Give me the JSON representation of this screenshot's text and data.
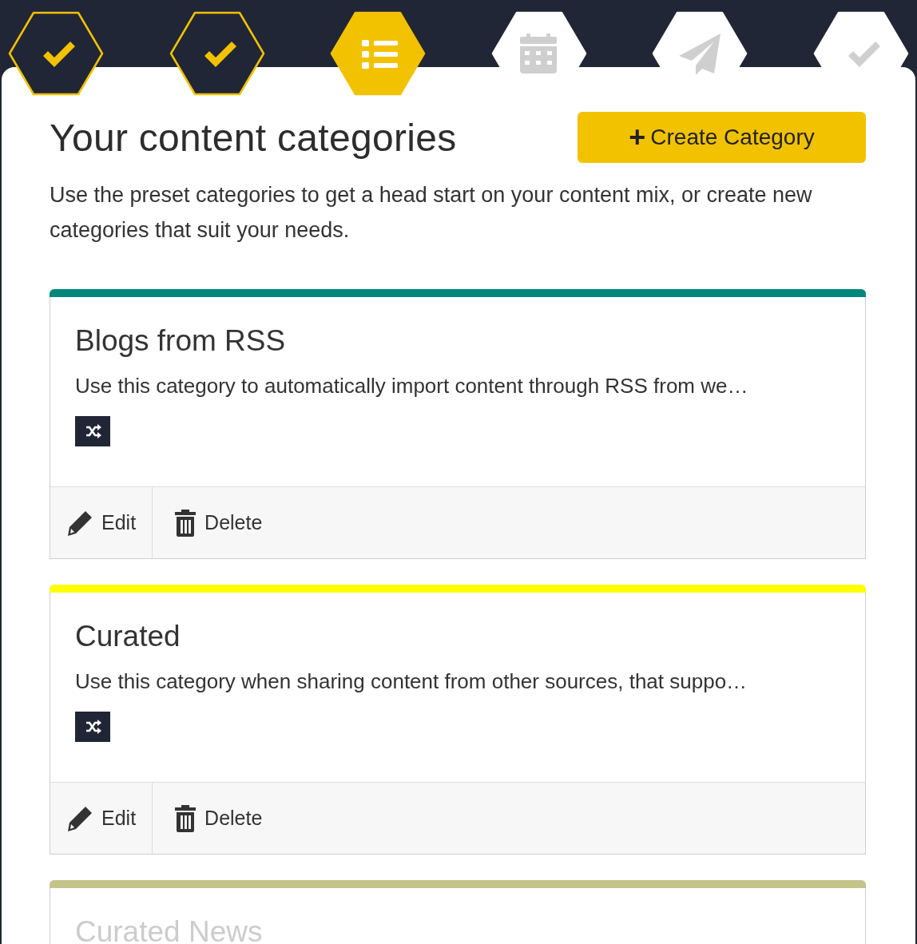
{
  "steps": [
    {
      "kind": "check",
      "completed": true,
      "selected": false
    },
    {
      "kind": "check",
      "completed": true,
      "selected": false
    },
    {
      "kind": "list",
      "completed": false,
      "selected": true
    },
    {
      "kind": "calendar",
      "completed": false,
      "selected": false
    },
    {
      "kind": "send",
      "completed": false,
      "selected": false
    },
    {
      "kind": "check",
      "completed": false,
      "selected": false
    }
  ],
  "heading": "Your content categories",
  "create_button": {
    "icon": "+",
    "label": "Create Category"
  },
  "description": "Use the preset categories to get a head start on your content mix, or create new categories that suit your needs.",
  "categories": [
    {
      "title": "Blogs from RSS",
      "description": "Use this category to automatically import content through RSS from we…",
      "color": "#00877c",
      "faded": false,
      "actions": [
        "Edit",
        "Delete"
      ]
    },
    {
      "title": "Curated",
      "description": "Use this category when sharing content from other sources, that suppo…",
      "color": "#ffff00",
      "faded": false,
      "actions": [
        "Edit",
        "Delete"
      ]
    },
    {
      "title": "Curated News",
      "color": "#c4c48a",
      "faded": true
    }
  ]
}
